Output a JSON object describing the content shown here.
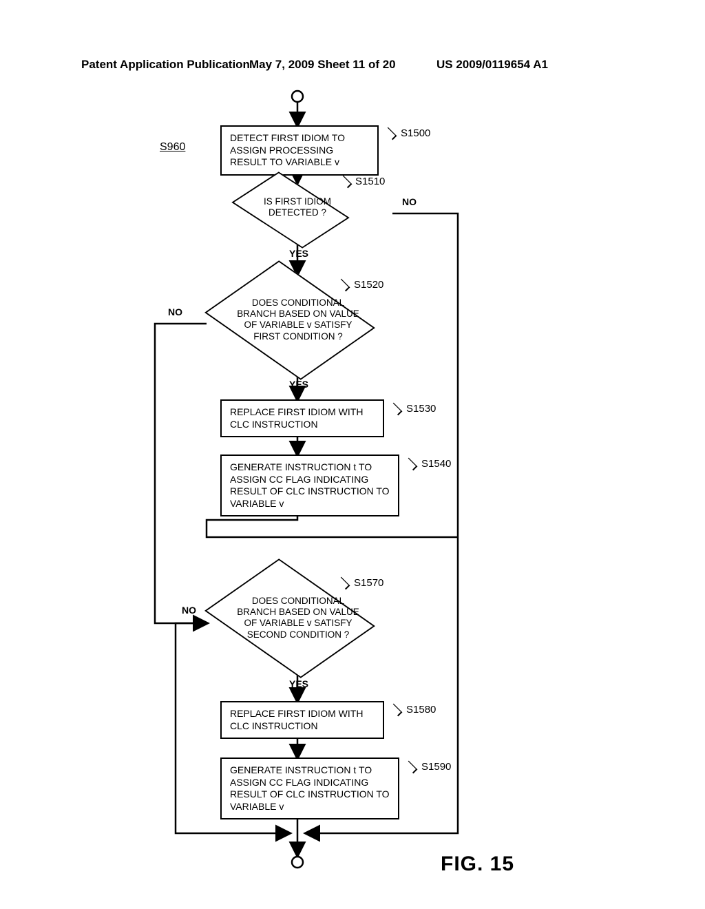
{
  "header": {
    "left": "Patent Application Publication",
    "mid": "May 7, 2009  Sheet 11 of 20",
    "right": "US 2009/0119654 A1"
  },
  "figure": "FIG. 15",
  "section_ref": "S960",
  "steps": {
    "s1500": "S1500",
    "s1510": "S1510",
    "s1520": "S1520",
    "s1530": "S1530",
    "s1540": "S1540",
    "s1570": "S1570",
    "s1580": "S1580",
    "s1590": "S1590"
  },
  "blocks": {
    "b1500": "DETECT FIRST IDIOM TO ASSIGN PROCESSING RESULT TO VARIABLE v",
    "d1510": "IS FIRST IDIOM DETECTED ?",
    "d1520": "DOES CONDITIONAL BRANCH BASED ON VALUE OF VARIABLE v SATISFY FIRST CONDITION ?",
    "b1530": "REPLACE FIRST IDIOM WITH CLC INSTRUCTION",
    "b1540": "GENERATE INSTRUCTION t TO ASSIGN CC FLAG INDICATING RESULT OF CLC INSTRUCTION TO VARIABLE v",
    "d1570": "DOES CONDITIONAL BRANCH BASED ON VALUE OF VARIABLE v SATISFY SECOND CONDITION ?",
    "b1580": "REPLACE FIRST IDIOM WITH CLC INSTRUCTION",
    "b1590": "GENERATE INSTRUCTION t TO ASSIGN CC FLAG INDICATING RESULT OF CLC INSTRUCTION TO VARIABLE v"
  },
  "yn": {
    "yes": "YES",
    "no": "NO"
  }
}
